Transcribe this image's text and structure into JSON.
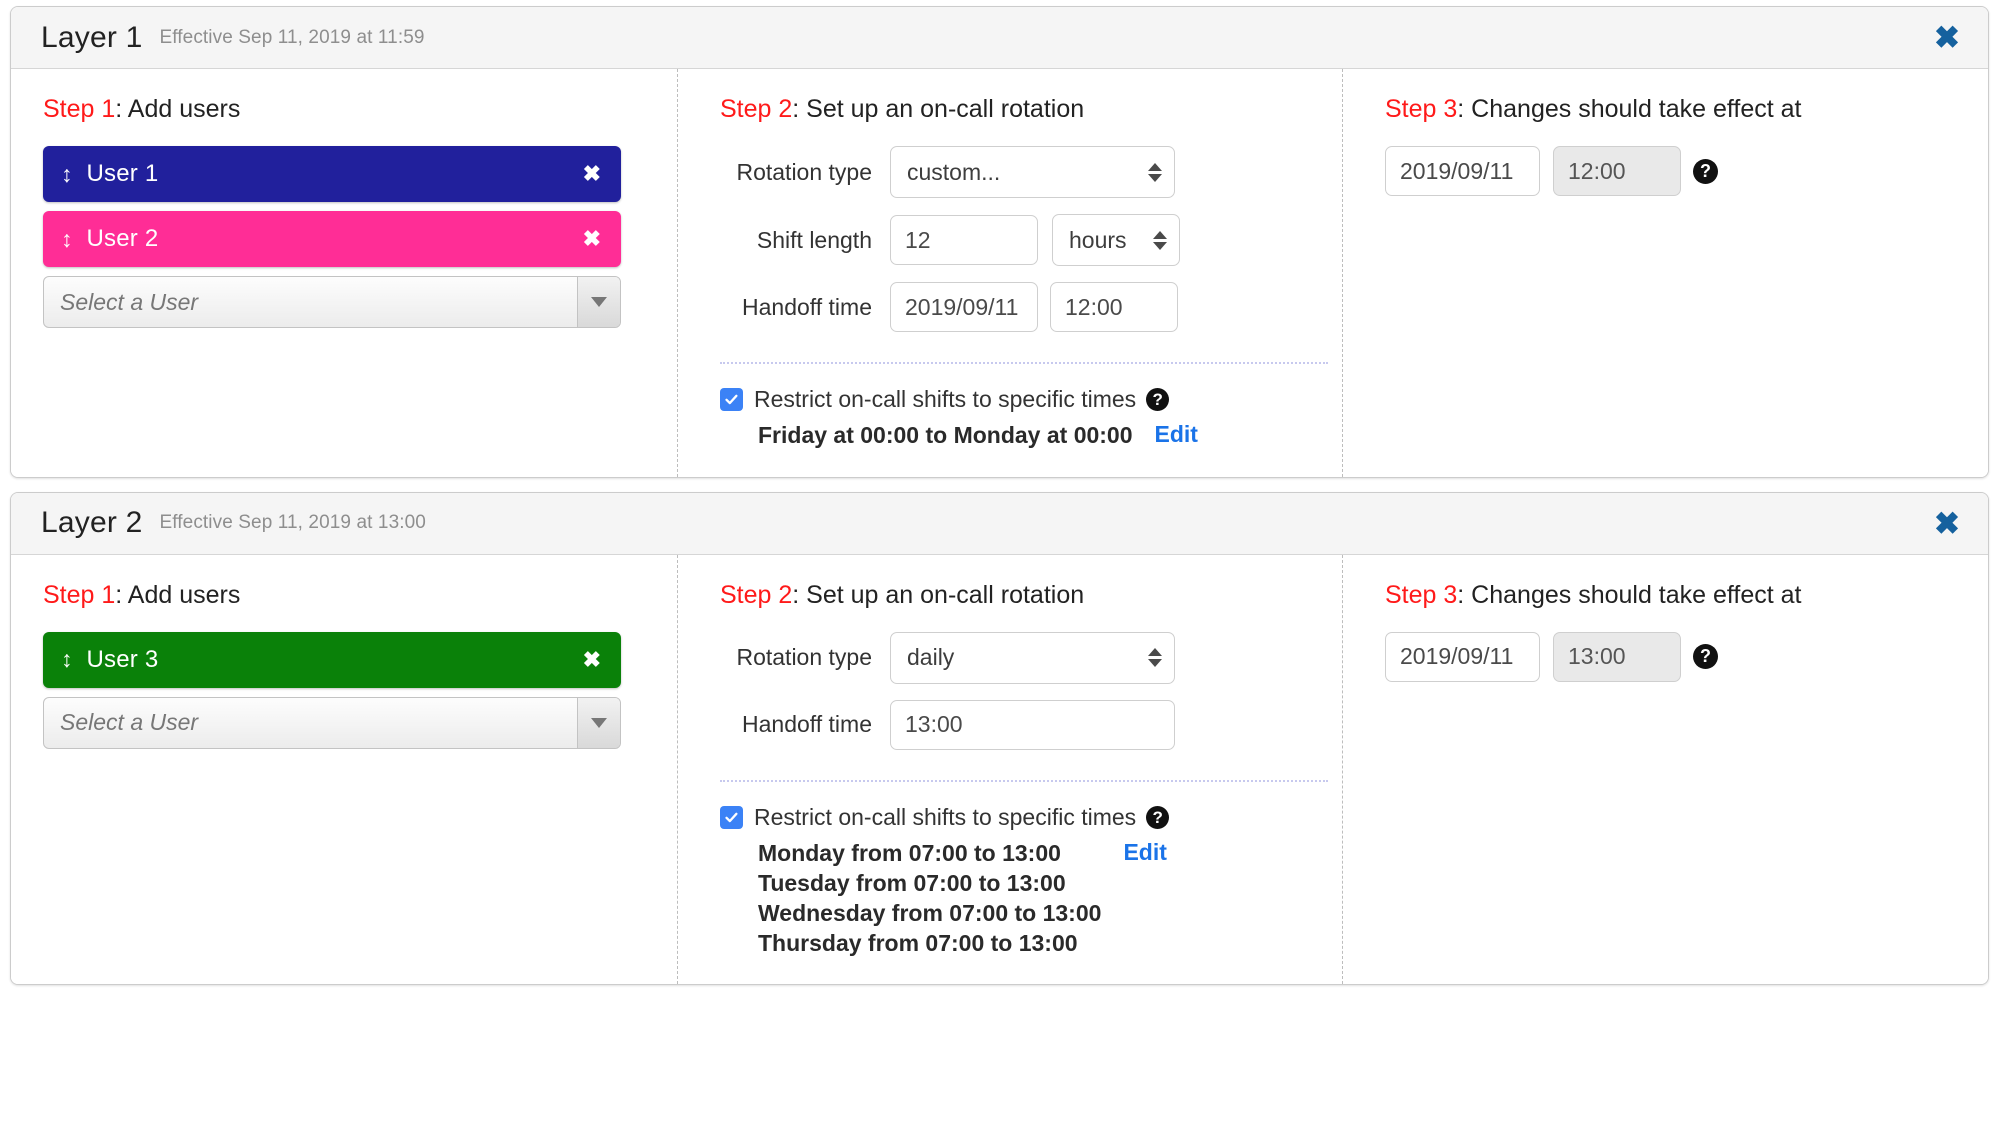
{
  "layers": [
    {
      "title": "Layer 1",
      "effective": "Effective Sep 11, 2019 at 11:59",
      "close_label": "✖",
      "step1": {
        "heading_num": "Step 1",
        "heading_rest": ": Add users",
        "users": [
          {
            "name": "User 1",
            "color": "#21209c",
            "drag_icon": "↕",
            "remove_label": "✖"
          },
          {
            "name": "User 2",
            "color": "#ff2d96",
            "drag_icon": "↕",
            "remove_label": "✖"
          }
        ],
        "select_placeholder": "Select a User"
      },
      "step2": {
        "heading_num": "Step 2",
        "heading_rest": ": Set up an on-call rotation",
        "rotation_type_label": "Rotation type",
        "rotation_type_value": "custom...",
        "shift_length_label": "Shift length",
        "shift_length_value": "12",
        "shift_unit_value": "hours",
        "handoff_label": "Handoff time",
        "handoff_date": "2019/09/11",
        "handoff_time": "12:00",
        "restrict_label": "Restrict on-call shifts to specific times",
        "restrict_checked": true,
        "help_glyph": "?",
        "restrict_lines": [
          "Friday at 00:00 to Monday at 00:00"
        ],
        "edit_label": "Edit"
      },
      "step3": {
        "heading_num": "Step 3",
        "heading_rest": ": Changes should take effect at",
        "date_value": "2019/09/11",
        "time_value": "12:00",
        "help_glyph": "?"
      }
    },
    {
      "title": "Layer 2",
      "effective": "Effective Sep 11, 2019 at 13:00",
      "close_label": "✖",
      "step1": {
        "heading_num": "Step 1",
        "heading_rest": ": Add users",
        "users": [
          {
            "name": "User 3",
            "color": "#0a8109",
            "drag_icon": "↕",
            "remove_label": "✖"
          }
        ],
        "select_placeholder": "Select a User"
      },
      "step2": {
        "heading_num": "Step 2",
        "heading_rest": ": Set up an on-call rotation",
        "rotation_type_label": "Rotation type",
        "rotation_type_value": "daily",
        "handoff_label": "Handoff time",
        "handoff_time": "13:00",
        "restrict_label": "Restrict on-call shifts to specific times",
        "restrict_checked": true,
        "help_glyph": "?",
        "restrict_lines": [
          "Monday from 07:00 to 13:00",
          "Tuesday from 07:00 to 13:00",
          "Wednesday from 07:00 to 13:00",
          "Thursday from 07:00 to 13:00"
        ],
        "edit_label": "Edit"
      },
      "step3": {
        "heading_num": "Step 3",
        "heading_rest": ": Changes should take effect at",
        "date_value": "2019/09/11",
        "time_value": "13:00",
        "help_glyph": "?"
      }
    }
  ],
  "colors": {
    "step_accent": "#ff1a1a",
    "link": "#1a73e8",
    "close": "#15619e",
    "checkbox": "#3b82f6"
  }
}
